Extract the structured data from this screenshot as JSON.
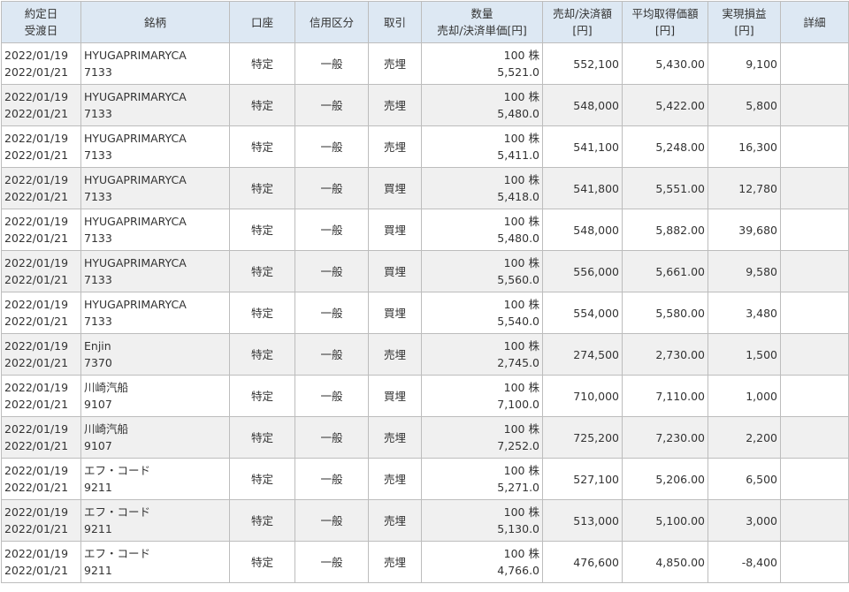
{
  "headers": {
    "date": [
      "約定日",
      "受渡日"
    ],
    "name": "銘柄",
    "account": "口座",
    "credit": "信用区分",
    "trade": "取引",
    "qty": [
      "数量",
      "売却/決済単価[円]"
    ],
    "amount": [
      "売却/決済額",
      "[円]"
    ],
    "avg": [
      "平均取得価額",
      "[円]"
    ],
    "pl": [
      "実現損益",
      "[円]"
    ],
    "detail": "詳細"
  },
  "rows": [
    {
      "trade_date": "2022/01/19",
      "settle_date": "2022/01/21",
      "name": "HYUGAPRIMARYCA",
      "code": "7133",
      "account": "特定",
      "credit": "一般",
      "trade": "売埋",
      "qty": "100 株",
      "price": "5,521.0",
      "amount": "552,100",
      "avg": "5,430.00",
      "pl": "9,100"
    },
    {
      "trade_date": "2022/01/19",
      "settle_date": "2022/01/21",
      "name": "HYUGAPRIMARYCA",
      "code": "7133",
      "account": "特定",
      "credit": "一般",
      "trade": "売埋",
      "qty": "100 株",
      "price": "5,480.0",
      "amount": "548,000",
      "avg": "5,422.00",
      "pl": "5,800"
    },
    {
      "trade_date": "2022/01/19",
      "settle_date": "2022/01/21",
      "name": "HYUGAPRIMARYCA",
      "code": "7133",
      "account": "特定",
      "credit": "一般",
      "trade": "売埋",
      "qty": "100 株",
      "price": "5,411.0",
      "amount": "541,100",
      "avg": "5,248.00",
      "pl": "16,300"
    },
    {
      "trade_date": "2022/01/19",
      "settle_date": "2022/01/21",
      "name": "HYUGAPRIMARYCA",
      "code": "7133",
      "account": "特定",
      "credit": "一般",
      "trade": "買埋",
      "qty": "100 株",
      "price": "5,418.0",
      "amount": "541,800",
      "avg": "5,551.00",
      "pl": "12,780"
    },
    {
      "trade_date": "2022/01/19",
      "settle_date": "2022/01/21",
      "name": "HYUGAPRIMARYCA",
      "code": "7133",
      "account": "特定",
      "credit": "一般",
      "trade": "買埋",
      "qty": "100 株",
      "price": "5,480.0",
      "amount": "548,000",
      "avg": "5,882.00",
      "pl": "39,680"
    },
    {
      "trade_date": "2022/01/19",
      "settle_date": "2022/01/21",
      "name": "HYUGAPRIMARYCA",
      "code": "7133",
      "account": "特定",
      "credit": "一般",
      "trade": "買埋",
      "qty": "100 株",
      "price": "5,560.0",
      "amount": "556,000",
      "avg": "5,661.00",
      "pl": "9,580"
    },
    {
      "trade_date": "2022/01/19",
      "settle_date": "2022/01/21",
      "name": "HYUGAPRIMARYCA",
      "code": "7133",
      "account": "特定",
      "credit": "一般",
      "trade": "買埋",
      "qty": "100 株",
      "price": "5,540.0",
      "amount": "554,000",
      "avg": "5,580.00",
      "pl": "3,480"
    },
    {
      "trade_date": "2022/01/19",
      "settle_date": "2022/01/21",
      "name": "Enjin",
      "code": "7370",
      "account": "特定",
      "credit": "一般",
      "trade": "売埋",
      "qty": "100 株",
      "price": "2,745.0",
      "amount": "274,500",
      "avg": "2,730.00",
      "pl": "1,500"
    },
    {
      "trade_date": "2022/01/19",
      "settle_date": "2022/01/21",
      "name": "川崎汽船",
      "code": "9107",
      "account": "特定",
      "credit": "一般",
      "trade": "買埋",
      "qty": "100 株",
      "price": "7,100.0",
      "amount": "710,000",
      "avg": "7,110.00",
      "pl": "1,000"
    },
    {
      "trade_date": "2022/01/19",
      "settle_date": "2022/01/21",
      "name": "川崎汽船",
      "code": "9107",
      "account": "特定",
      "credit": "一般",
      "trade": "売埋",
      "qty": "100 株",
      "price": "7,252.0",
      "amount": "725,200",
      "avg": "7,230.00",
      "pl": "2,200"
    },
    {
      "trade_date": "2022/01/19",
      "settle_date": "2022/01/21",
      "name": "エフ・コード",
      "code": "9211",
      "account": "特定",
      "credit": "一般",
      "trade": "売埋",
      "qty": "100 株",
      "price": "5,271.0",
      "amount": "527,100",
      "avg": "5,206.00",
      "pl": "6,500"
    },
    {
      "trade_date": "2022/01/19",
      "settle_date": "2022/01/21",
      "name": "エフ・コード",
      "code": "9211",
      "account": "特定",
      "credit": "一般",
      "trade": "売埋",
      "qty": "100 株",
      "price": "5,130.0",
      "amount": "513,000",
      "avg": "5,100.00",
      "pl": "3,000"
    },
    {
      "trade_date": "2022/01/19",
      "settle_date": "2022/01/21",
      "name": "エフ・コード",
      "code": "9211",
      "account": "特定",
      "credit": "一般",
      "trade": "売埋",
      "qty": "100 株",
      "price": "4,766.0",
      "amount": "476,600",
      "avg": "4,850.00",
      "pl": "-8,400"
    }
  ]
}
